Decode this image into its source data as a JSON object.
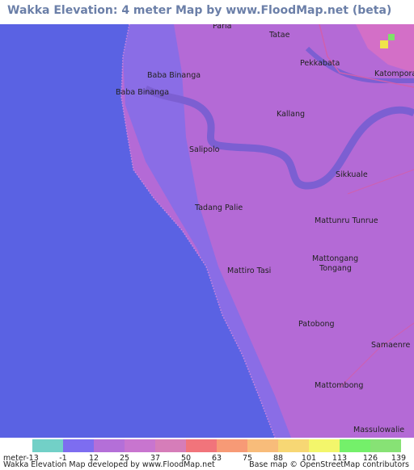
{
  "title": "Wakka Elevation: 4 meter Map by www.FloodMap.net (beta)",
  "map": {
    "places": [
      {
        "name": "Paria",
        "id": "paria"
      },
      {
        "name": "Tatae",
        "id": "tatae"
      },
      {
        "name": "Pekkabata",
        "id": "pekkabata"
      },
      {
        "name": "Katomporang",
        "id": "katomporang"
      },
      {
        "name": "Baba Binanga",
        "id": "baba-binanga-1"
      },
      {
        "name": "Baba Binanga",
        "id": "baba-binanga-2"
      },
      {
        "name": "Kallang",
        "id": "kallang"
      },
      {
        "name": "Salipolo",
        "id": "salipolo"
      },
      {
        "name": "Sikkuale",
        "id": "sikkuale"
      },
      {
        "name": "Tadang Palie",
        "id": "tadang-palie"
      },
      {
        "name": "Mattunru Tunrue",
        "id": "mattunru-tunrue"
      },
      {
        "name": "Mattongang",
        "id": "mattongang"
      },
      {
        "name": "Tongang",
        "id": "tongang"
      },
      {
        "name": "Mattiro Tasi",
        "id": "mattiro-tasi"
      },
      {
        "name": "Patobong",
        "id": "patobong"
      },
      {
        "name": "Samaenre",
        "id": "samaenre"
      },
      {
        "name": "Mattombong",
        "id": "mattombong"
      },
      {
        "name": "Massulowalie",
        "id": "massulowalie"
      }
    ],
    "colors": {
      "sea": "#5a62e3",
      "lowland": "#7b6de8",
      "land": "#b46ad6",
      "high": "#d36fc7",
      "river": "#7c5fd2",
      "peak": "#f0e44a"
    }
  },
  "legend": {
    "unit": "meter",
    "ticks": [
      "-13",
      "-1",
      "12",
      "25",
      "37",
      "50",
      "63",
      "75",
      "88",
      "101",
      "113",
      "126",
      "139"
    ],
    "colors": [
      "#72d0c7",
      "#7d6df0",
      "#b46fd8",
      "#c875cf",
      "#d67db9",
      "#f1747b",
      "#f79a76",
      "#f8bc7a",
      "#f7d774",
      "#f3f66b",
      "#74f06a",
      "#87e275"
    ],
    "credit_left": "Wakka Elevation Map developed by www.FloodMap.net",
    "credit_right": "Base map © OpenStreetMap contributors"
  }
}
